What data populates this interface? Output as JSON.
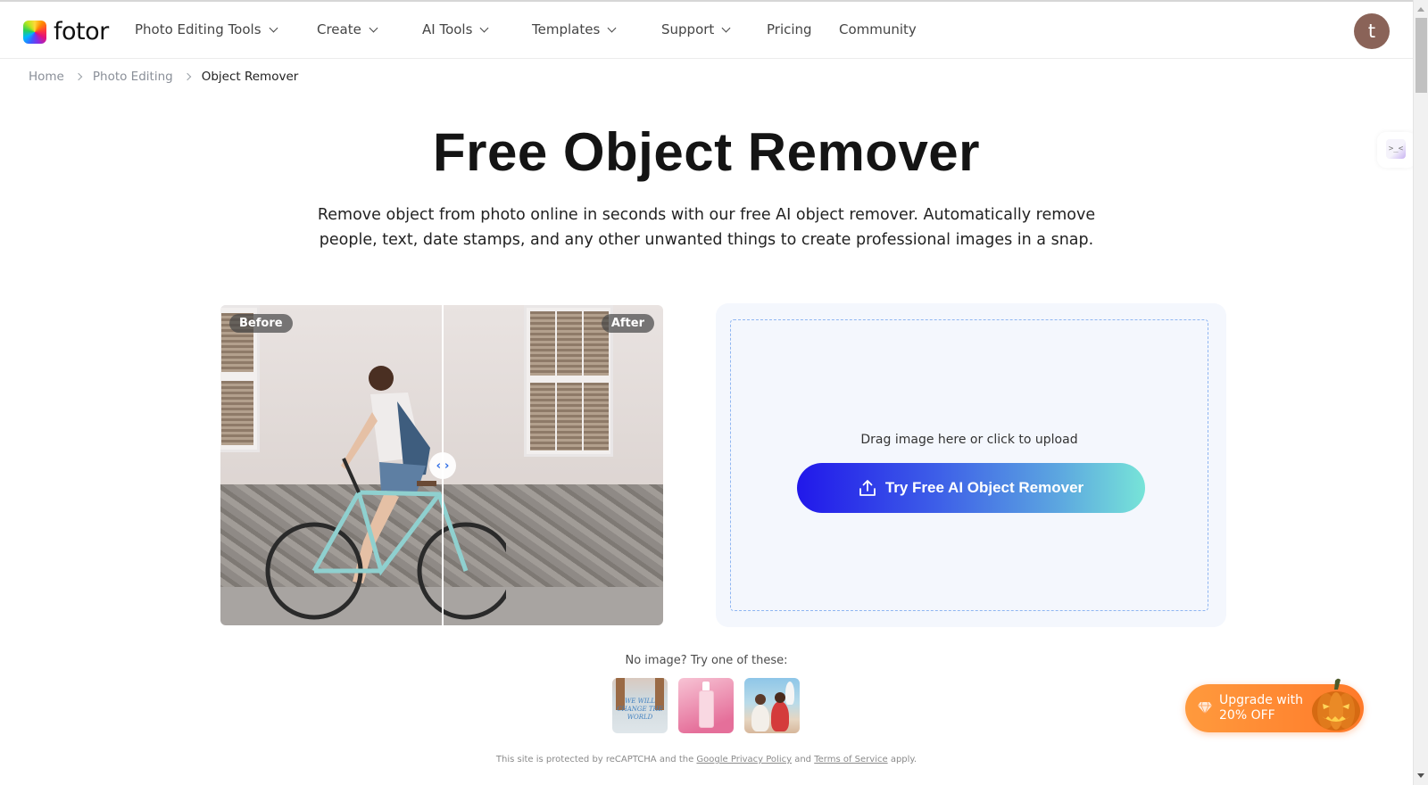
{
  "nav": {
    "logo_text": "fotor",
    "items": [
      {
        "label": "Photo Editing Tools",
        "dropdown": true
      },
      {
        "label": "Create",
        "dropdown": true
      },
      {
        "label": "AI Tools",
        "dropdown": true
      },
      {
        "label": "Templates",
        "dropdown": true
      },
      {
        "label": "Support",
        "dropdown": true
      },
      {
        "label": "Pricing",
        "dropdown": false
      },
      {
        "label": "Community",
        "dropdown": false
      }
    ],
    "avatar_initial": "t",
    "avatar_color": "#8a6358"
  },
  "breadcrumb": {
    "items": [
      "Home",
      "Photo Editing",
      "Object Remover"
    ]
  },
  "side_helper": {
    "icon_text": ">_<"
  },
  "hero": {
    "title": "Free Object Remover",
    "subtitle": "Remove object from photo online in seconds with our free AI object remover. Automatically remove people, text, date stamps, and any other unwanted things to create professional images in a snap."
  },
  "compare": {
    "before_label": "Before",
    "after_label": "After",
    "handle_left": "‹",
    "handle_right": "›"
  },
  "upload": {
    "hint": "Drag image here or click to upload",
    "button_label": "Try Free AI Object Remover",
    "gradient_start": "#2118ea",
    "gradient_end": "#77e4d8"
  },
  "samples": {
    "label": "No image? Try one of these:",
    "items": [
      {
        "name": "t-shirt",
        "text": "WE WILL CHANGE THE WORLD"
      },
      {
        "name": "skincare-bottle"
      },
      {
        "name": "beach-people"
      }
    ]
  },
  "footer": {
    "prefix": "This site is protected by reCAPTCHA and the",
    "privacy_link": "Google Privacy Policy",
    "middle": "and",
    "terms_link": "Terms of Service",
    "suffix": "apply."
  },
  "upgrade": {
    "line1": "Upgrade with",
    "line2": "20% OFF",
    "color": "#ff8a34"
  }
}
